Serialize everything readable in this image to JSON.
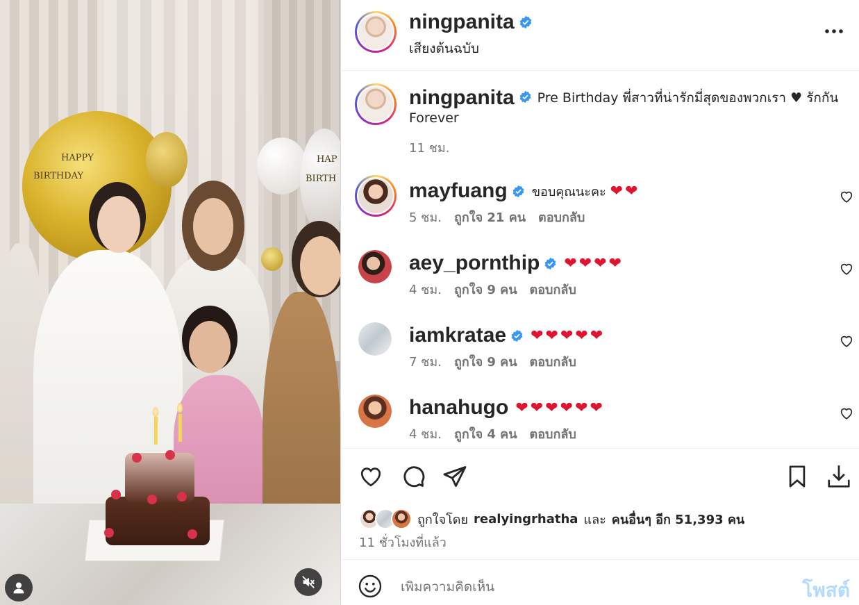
{
  "post": {
    "username": "ningpanita",
    "audio": "เสียงต้นฉบับ",
    "caption_username": "ningpanita",
    "caption_text": "Pre Birthday พี่สาวที่น่ารักมี่สุดของพวกเรา ♥ รักกัน Forever",
    "caption_time": "11 ชม."
  },
  "media": {
    "balloon_text_1": "HAPPY",
    "balloon_text_2": "BIRTHDAY",
    "balloon_text_3": "HAP",
    "balloon_text_4": "BIRTH"
  },
  "comments": [
    {
      "username": "mayfuang",
      "text": "ขอบคุณนะคะ",
      "hearts": "❤❤",
      "time": "5 ชม.",
      "likes": "ถูกใจ 21 คน",
      "reply": "ตอบกลับ"
    },
    {
      "username": "aey_pornthip",
      "text": "",
      "hearts": "❤❤❤❤",
      "time": "4 ชม.",
      "likes": "ถูกใจ 9 คน",
      "reply": "ตอบกลับ"
    },
    {
      "username": "iamkratae",
      "text": "",
      "hearts": "❤❤❤❤❤",
      "time": "7 ชม.",
      "likes": "ถูกใจ 9 คน",
      "reply": "ตอบกลับ"
    },
    {
      "username": "hanahugo",
      "text": "",
      "hearts": "❤❤❤❤❤❤",
      "time": "4 ชม.",
      "likes": "ถูกใจ 4 คน",
      "reply": "ตอบกลับ"
    }
  ],
  "likes_summary": {
    "prefix": "ถูกใจโดย",
    "user": "realyingrhatha",
    "middle": "และ",
    "others": "คนอื่นๆ อีก 51,393 คน"
  },
  "posted_ago": "11 ชั่วโมงที่แล้ว",
  "composer": {
    "placeholder": "เพิ่มความคิดเห็น",
    "post_label": "โพสต์"
  },
  "icons": {
    "verified": "verified-badge-icon",
    "more": "more-options-icon",
    "like": "heart-icon",
    "comment": "comment-icon",
    "share": "share-icon",
    "save": "bookmark-icon",
    "download": "download-icon",
    "emoji": "emoji-icon",
    "mute": "muted-speaker-icon",
    "user": "user-tags-icon"
  },
  "colors": {
    "verified": "#3897f0",
    "heart": "#e0142f",
    "post_disabled": "#b3dbff",
    "secondary_text": "#737373"
  }
}
